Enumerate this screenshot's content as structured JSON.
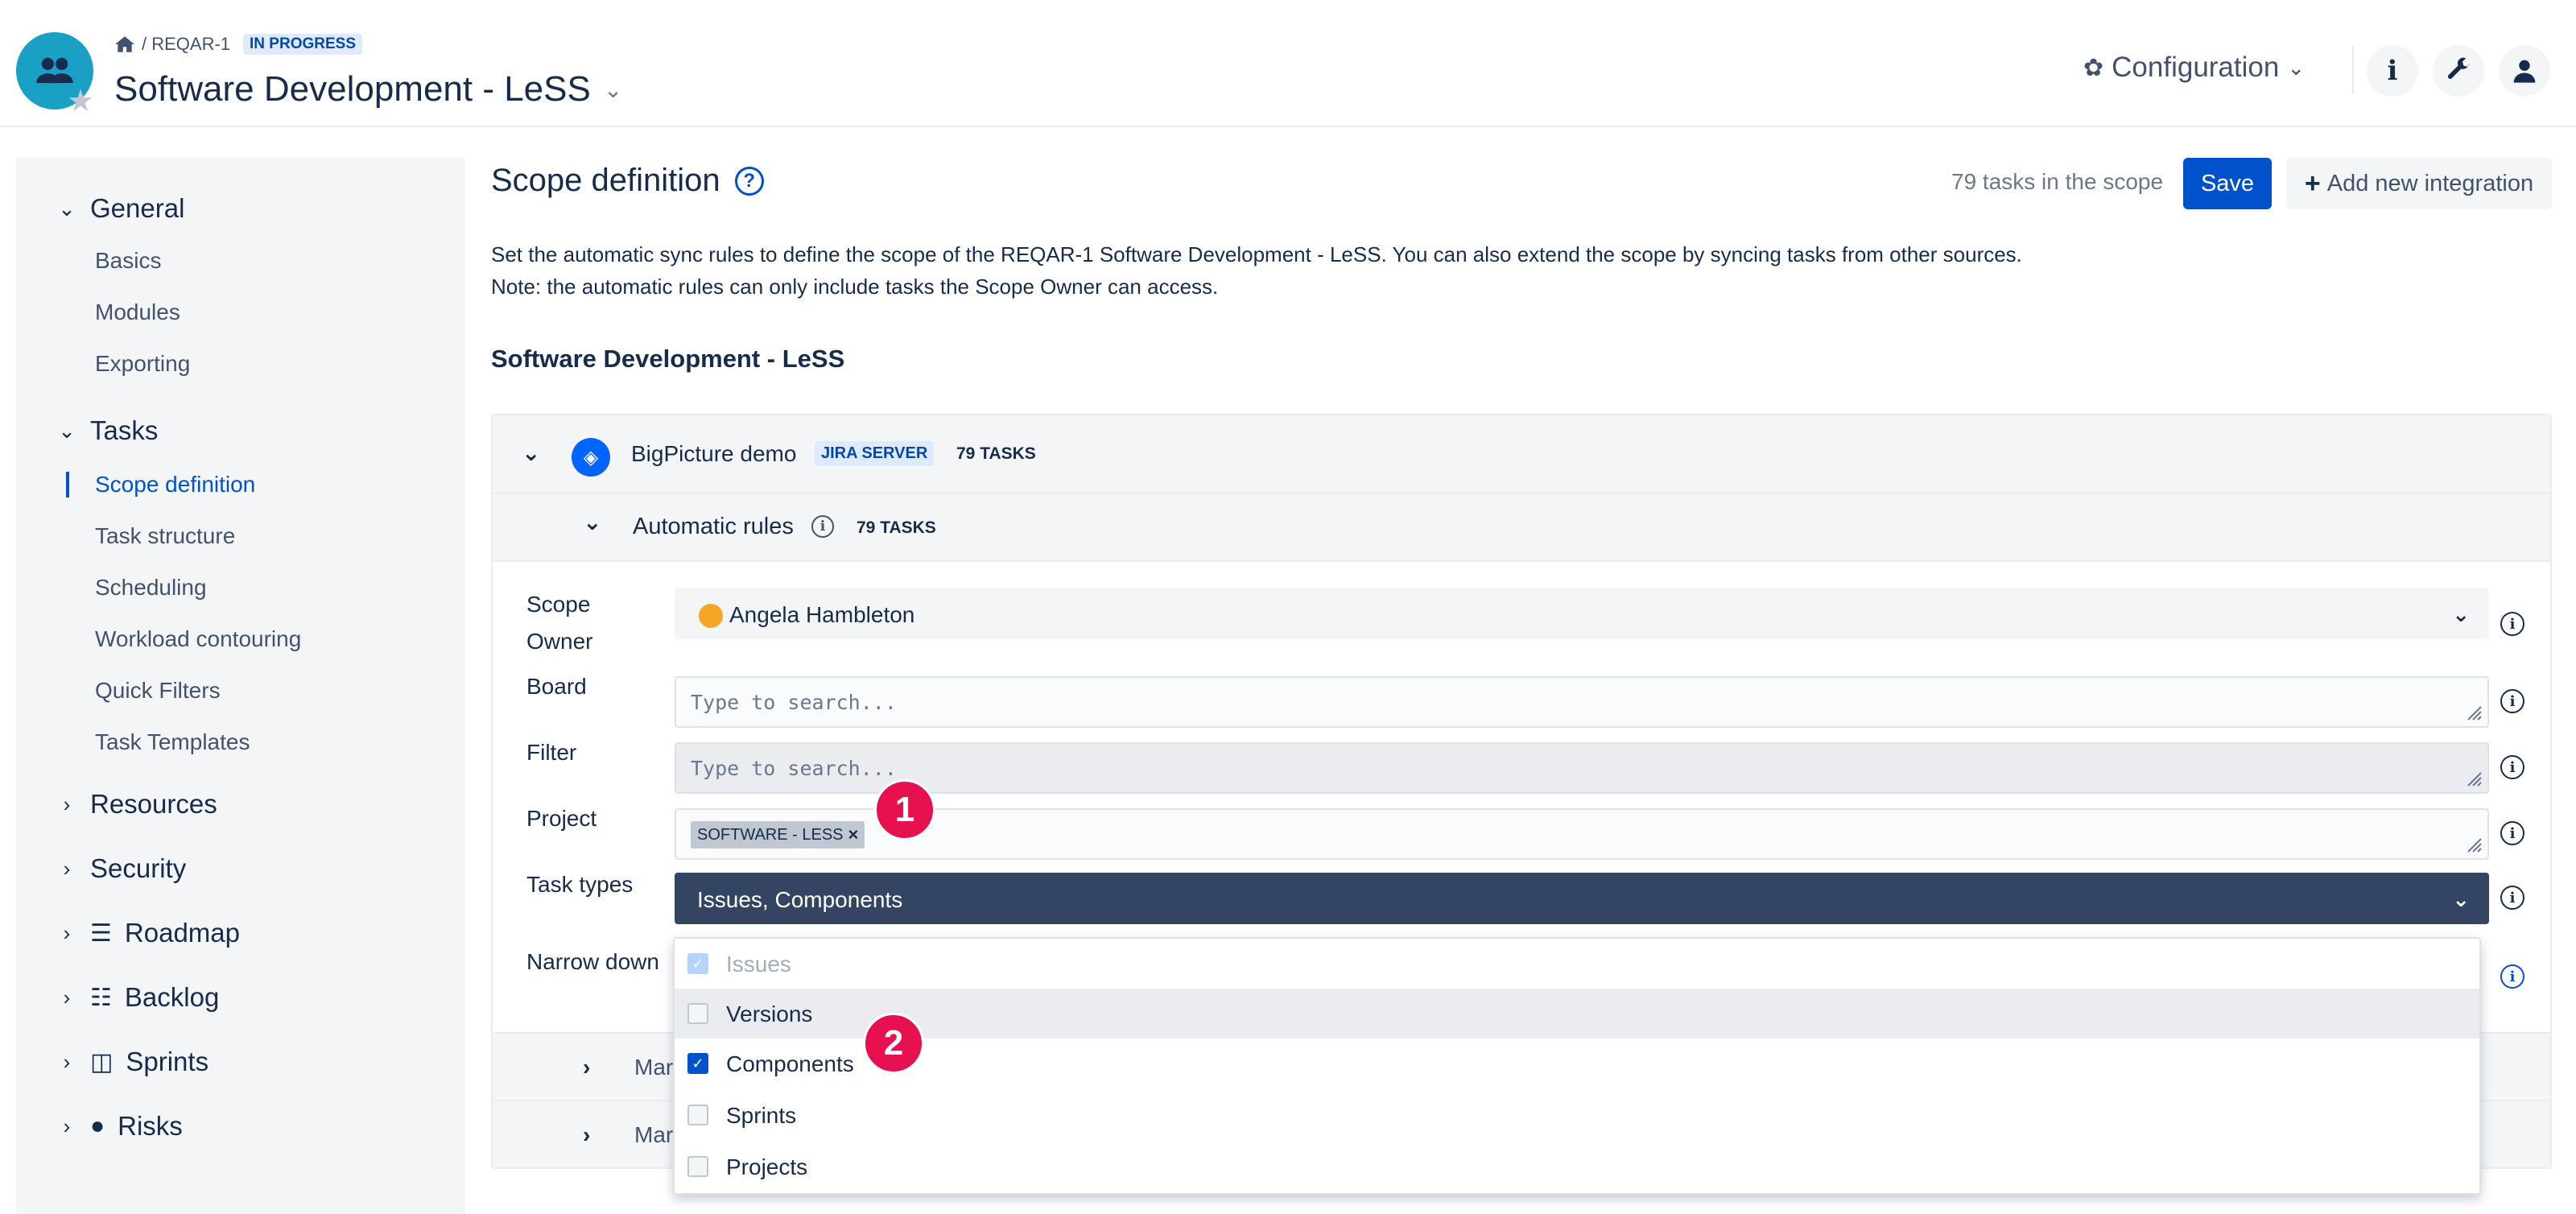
{
  "header": {
    "breadcrumb_path": "/ REQAR-1",
    "status_badge": "IN PROGRESS",
    "project_title": "Software Development - LeSS",
    "title_chevron": "⌄",
    "configuration_label": "Configuration",
    "icons": [
      "home-icon",
      "people-icon",
      "star-icon",
      "gear-icon",
      "info-icon",
      "wrench-icon",
      "user-icon"
    ]
  },
  "sidebar": {
    "general": {
      "label": "General",
      "items": [
        "Basics",
        "Modules",
        "Exporting"
      ]
    },
    "tasks": {
      "label": "Tasks",
      "items": [
        "Scope definition",
        "Task structure",
        "Scheduling",
        "Workload contouring",
        "Quick Filters",
        "Task Templates"
      ],
      "active": "Scope definition"
    },
    "groups": [
      "Resources",
      "Security",
      "Roadmap",
      "Backlog",
      "Sprints",
      "Risks"
    ]
  },
  "main": {
    "title": "Scope definition",
    "tasks_in_scope": "79 tasks in the scope",
    "save_label": "Save",
    "add_integration_label": "Add new integration",
    "description": "Set the automatic sync rules to define the scope of the REQAR-1 Software Development - LeSS. You can also extend the scope by syncing tasks from other sources. Note: the automatic rules can only include tasks the Scope Owner can access.",
    "section_title": "Software Development - LeSS",
    "integration": {
      "name": "BigPicture demo",
      "type_badge": "JIRA SERVER",
      "task_count": "79 TASKS"
    },
    "automatic_rules": {
      "label": "Automatic rules",
      "task_count": "79 TASKS"
    },
    "form": {
      "scope_owner_label": "Scope Owner",
      "scope_owner_value": "Angela Hambleton",
      "board_label": "Board",
      "board_placeholder": "Type to search...",
      "filter_label": "Filter",
      "filter_placeholder": "Type to search...",
      "project_label": "Project",
      "project_chip": "SOFTWARE - LESS",
      "task_types_label": "Task types",
      "task_types_value": "Issues, Components",
      "narrow_down_label": "Narrow down"
    },
    "collapsed_rows": [
      "Mar",
      "Mar"
    ]
  },
  "dropdown": {
    "options": [
      {
        "label": "Issues",
        "checked": true,
        "disabled": true
      },
      {
        "label": "Versions",
        "checked": false,
        "disabled": false
      },
      {
        "label": "Components",
        "checked": true,
        "disabled": false
      },
      {
        "label": "Sprints",
        "checked": false,
        "disabled": false
      },
      {
        "label": "Projects",
        "checked": false,
        "disabled": false
      }
    ]
  },
  "callouts": [
    "1",
    "2"
  ],
  "colors": {
    "accent": "#0052cc",
    "callout": "#e8114f",
    "dark_select": "#344563",
    "project_avatar": "#1aa0c4"
  }
}
